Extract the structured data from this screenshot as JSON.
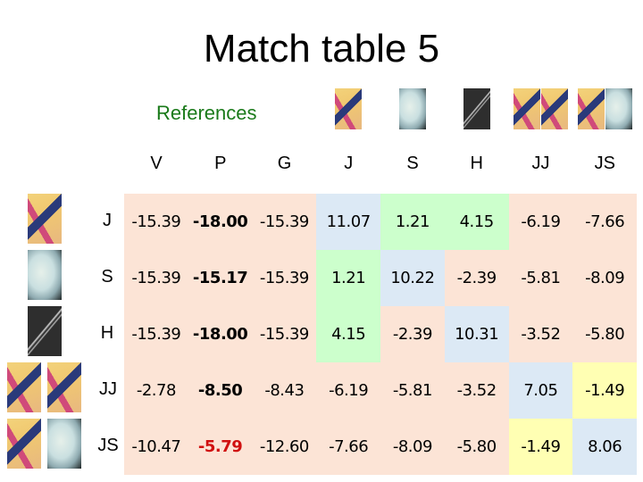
{
  "title": "Match table 5",
  "references_label": "References",
  "reference_images": [
    {
      "id": "J",
      "icon": "image-thumbnail-j",
      "parts": [
        "art-j"
      ]
    },
    {
      "id": "S",
      "icon": "image-thumbnail-s",
      "parts": [
        "art-s"
      ]
    },
    {
      "id": "H",
      "icon": "image-thumbnail-h",
      "parts": [
        "art-h"
      ]
    },
    {
      "id": "JJ",
      "icon": "image-thumbnail-jj",
      "parts": [
        "art-j",
        "art-j"
      ]
    },
    {
      "id": "JS",
      "icon": "image-thumbnail-js",
      "parts": [
        "art-j",
        "art-s"
      ]
    }
  ],
  "columns": [
    "V",
    "P",
    "G",
    "J",
    "S",
    "H",
    "JJ",
    "JS"
  ],
  "rows": [
    {
      "label": "J",
      "cells": [
        {
          "v": "-15.39",
          "c": "neg"
        },
        {
          "v": "-18.00",
          "c": "neg",
          "b": true
        },
        {
          "v": "-15.39",
          "c": "neg"
        },
        {
          "v": "11.07",
          "c": "self"
        },
        {
          "v": "1.21",
          "c": "pos"
        },
        {
          "v": "4.15",
          "c": "pos"
        },
        {
          "v": "-6.19",
          "c": "neg"
        },
        {
          "v": "-7.66",
          "c": "neg"
        }
      ]
    },
    {
      "label": "S",
      "cells": [
        {
          "v": "-15.39",
          "c": "neg"
        },
        {
          "v": "-15.17",
          "c": "neg",
          "b": true
        },
        {
          "v": "-15.39",
          "c": "neg"
        },
        {
          "v": "1.21",
          "c": "pos"
        },
        {
          "v": "10.22",
          "c": "self"
        },
        {
          "v": "-2.39",
          "c": "neg"
        },
        {
          "v": "-5.81",
          "c": "neg"
        },
        {
          "v": "-8.09",
          "c": "neg"
        }
      ]
    },
    {
      "label": "H",
      "cells": [
        {
          "v": "-15.39",
          "c": "neg"
        },
        {
          "v": "-18.00",
          "c": "neg",
          "b": true
        },
        {
          "v": "-15.39",
          "c": "neg"
        },
        {
          "v": "4.15",
          "c": "pos"
        },
        {
          "v": "-2.39",
          "c": "neg"
        },
        {
          "v": "10.31",
          "c": "self"
        },
        {
          "v": "-3.52",
          "c": "neg"
        },
        {
          "v": "-5.80",
          "c": "neg"
        }
      ]
    },
    {
      "label": "JJ",
      "cells": [
        {
          "v": "-2.78",
          "c": "neg"
        },
        {
          "v": "-8.50",
          "c": "neg",
          "b": true
        },
        {
          "v": "-8.43",
          "c": "neg"
        },
        {
          "v": "-6.19",
          "c": "neg"
        },
        {
          "v": "-5.81",
          "c": "neg"
        },
        {
          "v": "-3.52",
          "c": "neg"
        },
        {
          "v": "7.05",
          "c": "self"
        },
        {
          "v": "-1.49",
          "c": "pair"
        }
      ]
    },
    {
      "label": "JS",
      "cells": [
        {
          "v": "-10.47",
          "c": "neg"
        },
        {
          "v": "-5.79",
          "c": "neg",
          "b": true,
          "red": true
        },
        {
          "v": "-12.60",
          "c": "neg"
        },
        {
          "v": "-7.66",
          "c": "neg"
        },
        {
          "v": "-8.09",
          "c": "neg"
        },
        {
          "v": "-5.80",
          "c": "neg"
        },
        {
          "v": "-1.49",
          "c": "pair"
        },
        {
          "v": "8.06",
          "c": "self"
        }
      ]
    }
  ],
  "colors": {
    "negative_bg": "#fce4d6",
    "self_match_bg": "#dce9f5",
    "positive_bg": "#ccffcc",
    "pair_bg": "#ffffb3",
    "highlight_red": "#d01010",
    "references_green": "#1a7a1a"
  }
}
